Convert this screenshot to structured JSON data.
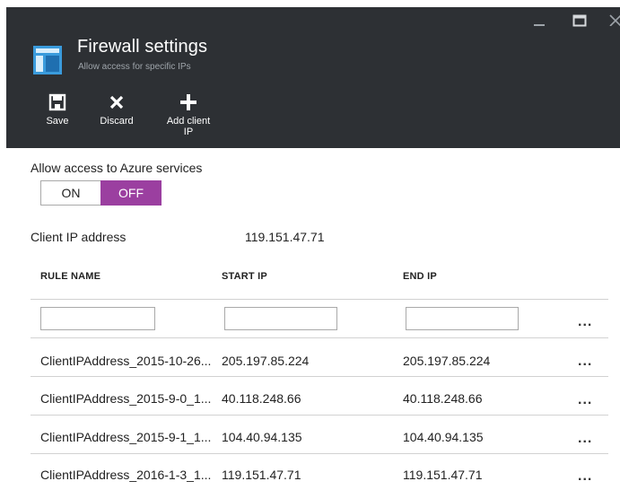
{
  "blade": {
    "title": "Firewall settings",
    "subtitle": "Allow access for specific IPs"
  },
  "window_controls": {
    "minimize_icon": "minimize-icon",
    "maximize_icon": "maximize-icon",
    "close_icon": "close-icon"
  },
  "commands": {
    "save_label": "Save",
    "discard_label": "Discard",
    "add_client_label_line1": "Add client",
    "add_client_label_line2": "IP"
  },
  "azure_access": {
    "label": "Allow access to Azure services",
    "on_label": "ON",
    "off_label": "OFF",
    "selected": "OFF"
  },
  "client_ip": {
    "label": "Client IP address",
    "value": "119.151.47.71"
  },
  "table": {
    "columns": [
      "RULE NAME",
      "START IP",
      "END IP"
    ],
    "new_rule": {
      "name": "",
      "start_ip": "",
      "end_ip": ""
    },
    "more_label": "...",
    "rows": [
      {
        "name": "ClientIPAddress_2015-10-26...",
        "start_ip": "205.197.85.224",
        "end_ip": "205.197.85.224"
      },
      {
        "name": "ClientIPAddress_2015-9-0_1...",
        "start_ip": "40.118.248.66",
        "end_ip": "40.118.248.66"
      },
      {
        "name": "ClientIPAddress_2015-9-1_1...",
        "start_ip": "104.40.94.135",
        "end_ip": "104.40.94.135"
      },
      {
        "name": "ClientIPAddress_2016-1-3_1...",
        "start_ip": "119.151.47.71",
        "end_ip": "119.151.47.71"
      }
    ]
  },
  "colors": {
    "header_bg": "#2d3034",
    "accent_purple": "#9b3fa0",
    "icon_blue": "#3a9bdc"
  }
}
